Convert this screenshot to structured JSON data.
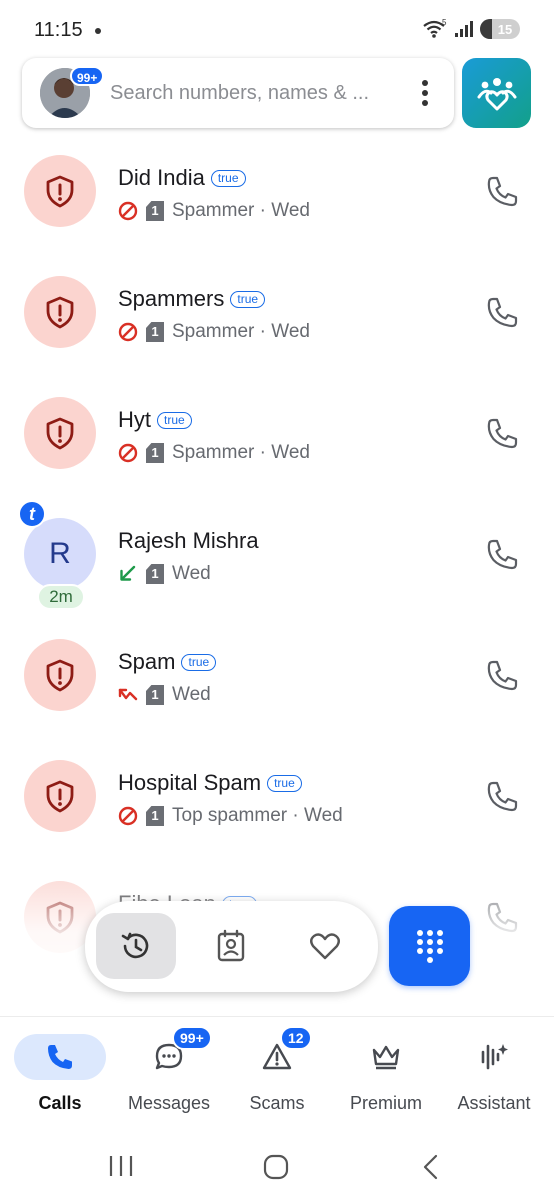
{
  "status_bar": {
    "time": "11:15",
    "wifi_label": "5",
    "battery": "15"
  },
  "search": {
    "placeholder": "Search numbers, names & ...",
    "avatar_badge": "99+"
  },
  "calls": [
    {
      "avatar": "spam-shield",
      "name": "Did India",
      "verified_tag": "true",
      "call_type": "blocked",
      "sim": "1",
      "meta": "Spammer · Wed"
    },
    {
      "avatar": "spam-shield",
      "name": "Spammers",
      "verified_tag": "true",
      "call_type": "blocked",
      "sim": "1",
      "meta": "Spammer · Wed"
    },
    {
      "avatar": "spam-shield",
      "name": "Hyt",
      "verified_tag": "true",
      "call_type": "blocked",
      "sim": "1",
      "meta": "Spammer · Wed"
    },
    {
      "avatar": "letter",
      "avatar_letter": "R",
      "avatar_badge": "t",
      "duration": "2m",
      "name": "Rajesh Mishra",
      "verified_tag": "",
      "call_type": "incoming",
      "sim": "1",
      "meta": "Wed"
    },
    {
      "avatar": "spam-shield",
      "name": "Spam",
      "verified_tag": "true",
      "call_type": "missed",
      "sim": "1",
      "meta": "Wed"
    },
    {
      "avatar": "spam-shield",
      "name": "Hospital Spam",
      "verified_tag": "true",
      "call_type": "blocked",
      "sim": "1",
      "meta": "Top spammer · Wed"
    },
    {
      "avatar": "spam-shield",
      "name": "Fibe Loan",
      "verified_tag": "true",
      "call_type": "blocked",
      "sim": "1",
      "meta": ""
    }
  ],
  "floating_bar": {
    "tabs": [
      "recents",
      "contacts",
      "favorites"
    ],
    "active": "recents"
  },
  "bottom_nav": [
    {
      "label": "Calls",
      "icon": "phone-icon",
      "badge": "",
      "active": true
    },
    {
      "label": "Messages",
      "icon": "message-icon",
      "badge": "99+",
      "active": false
    },
    {
      "label": "Scams",
      "icon": "warning-icon",
      "badge": "12",
      "active": false
    },
    {
      "label": "Premium",
      "icon": "crown-icon",
      "badge": "",
      "active": false
    },
    {
      "label": "Assistant",
      "icon": "assistant-icon",
      "badge": "",
      "active": false
    }
  ],
  "colors": {
    "accent": "#1765f3",
    "spam_bg": "#fbd4cf",
    "spam_icon": "#b3261e",
    "incoming_green": "#1e9a4a",
    "missed_red": "#d93025"
  }
}
